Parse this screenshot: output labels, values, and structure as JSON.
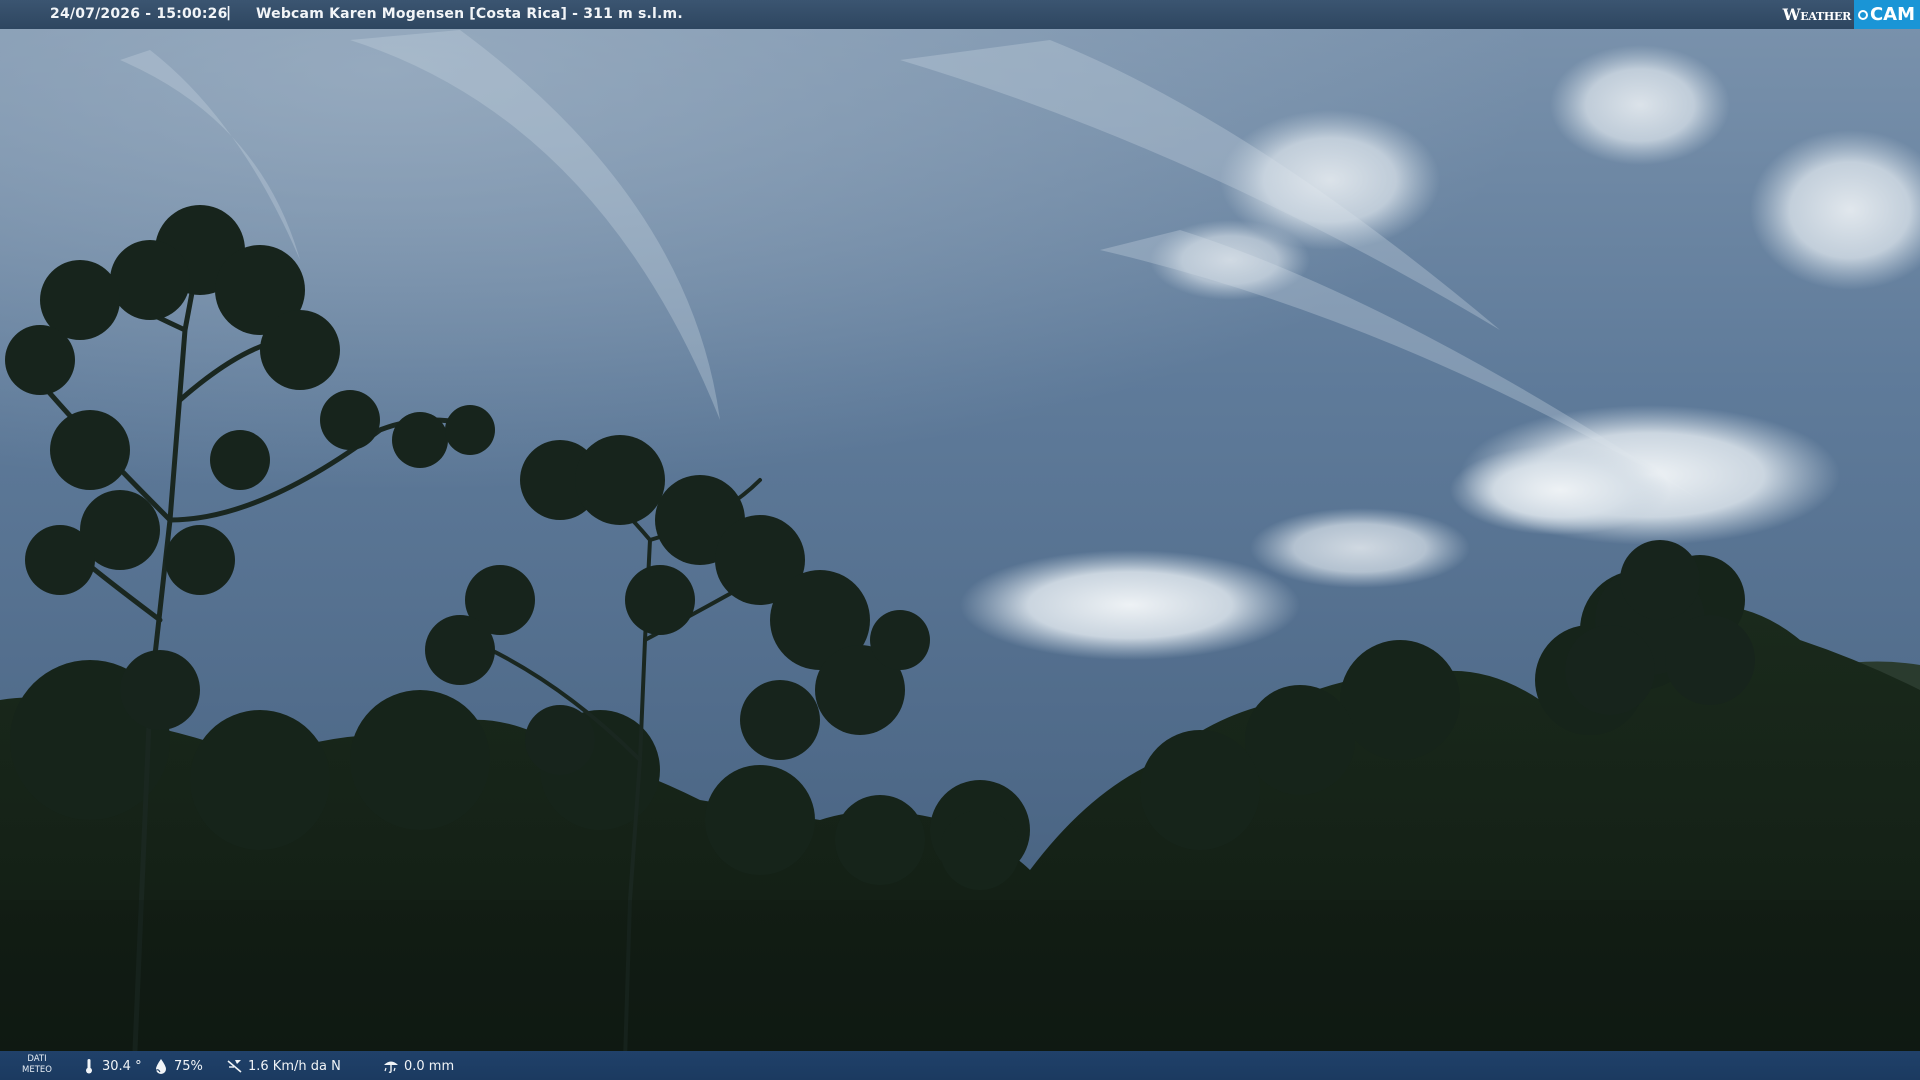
{
  "header": {
    "datetime": "24/07/2026 - 15:00:26",
    "separator": "|",
    "title": "Webcam Karen Mogensen [Costa Rica]  - 311 m s.l.m."
  },
  "logo": {
    "weather": "Weather",
    "cam": "CAM"
  },
  "footer": {
    "dati_line1": "DATI",
    "dati_line2": "METEO",
    "temperature": "30.4 °",
    "humidity": "75%",
    "wind": "1.6 Km/h da N",
    "rain": "0.0 mm"
  },
  "icons": [
    "thermometer-icon",
    "humidity-icon",
    "wind-icon",
    "rain-gauge-icon"
  ],
  "colors": {
    "bar": "#2e4660",
    "footer": "#1b3a60",
    "logo_accent": "#1a95d6"
  }
}
